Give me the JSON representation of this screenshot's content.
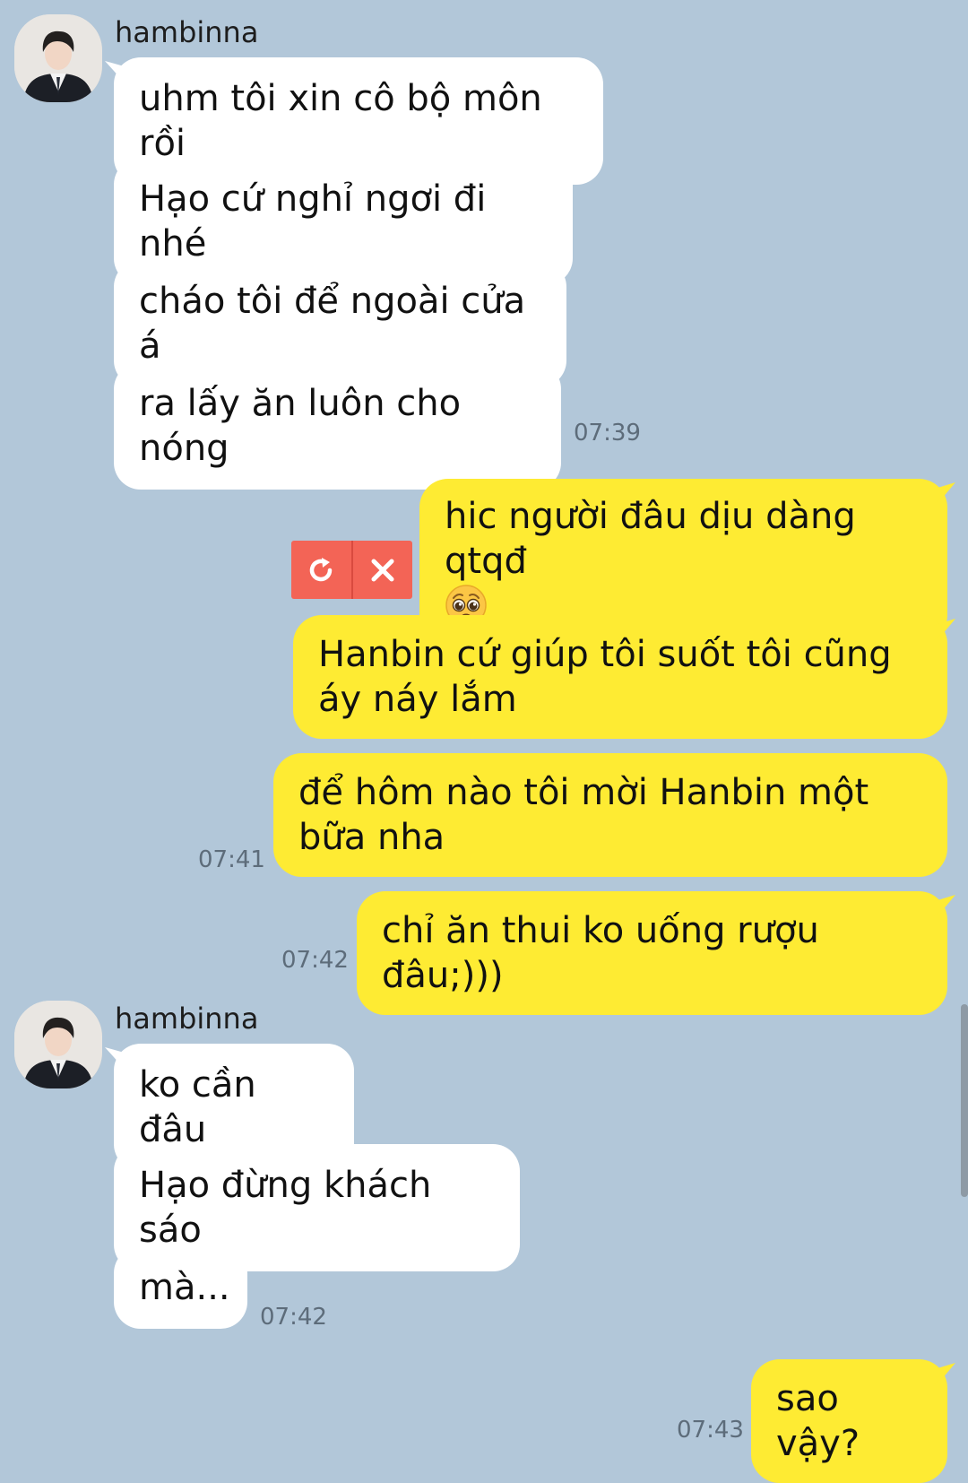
{
  "colors": {
    "background": "#b2c7d9",
    "incoming_bubble": "#ffffff",
    "outgoing_bubble": "#feeb33",
    "failed_action": "#f36456"
  },
  "group1": {
    "sender": "hambinna",
    "messages": [
      "uhm tôi xin cô bộ môn rồi",
      "Hạo cứ nghỉ ngơi đi nhé",
      "cháo tôi để ngoài cửa á",
      "ra lấy ăn luôn cho nóng"
    ],
    "time": "07:39"
  },
  "outgoing": {
    "failed_message": "hic người đâu dịu dàng qtqđ",
    "failed_message_emoji": "pleading-face-icon",
    "message2": "Hanbin cứ giúp tôi suốt tôi cũng áy náy lắm",
    "message3": "để hôm nào tôi mời Hanbin một bữa nha",
    "time1": "07:41",
    "message4": "chỉ ăn thui ko uống rượu đâu;)))",
    "time2": "07:42"
  },
  "retry_actions": {
    "retry_icon": "retry-icon",
    "delete_icon": "close-icon"
  },
  "group2": {
    "sender": "hambinna",
    "messages": [
      "ko cần đâu",
      "Hạo đừng khách sáo",
      "mà..."
    ],
    "time": "07:42"
  },
  "last_outgoing": {
    "message": "sao vậy?",
    "time": "07:43"
  }
}
